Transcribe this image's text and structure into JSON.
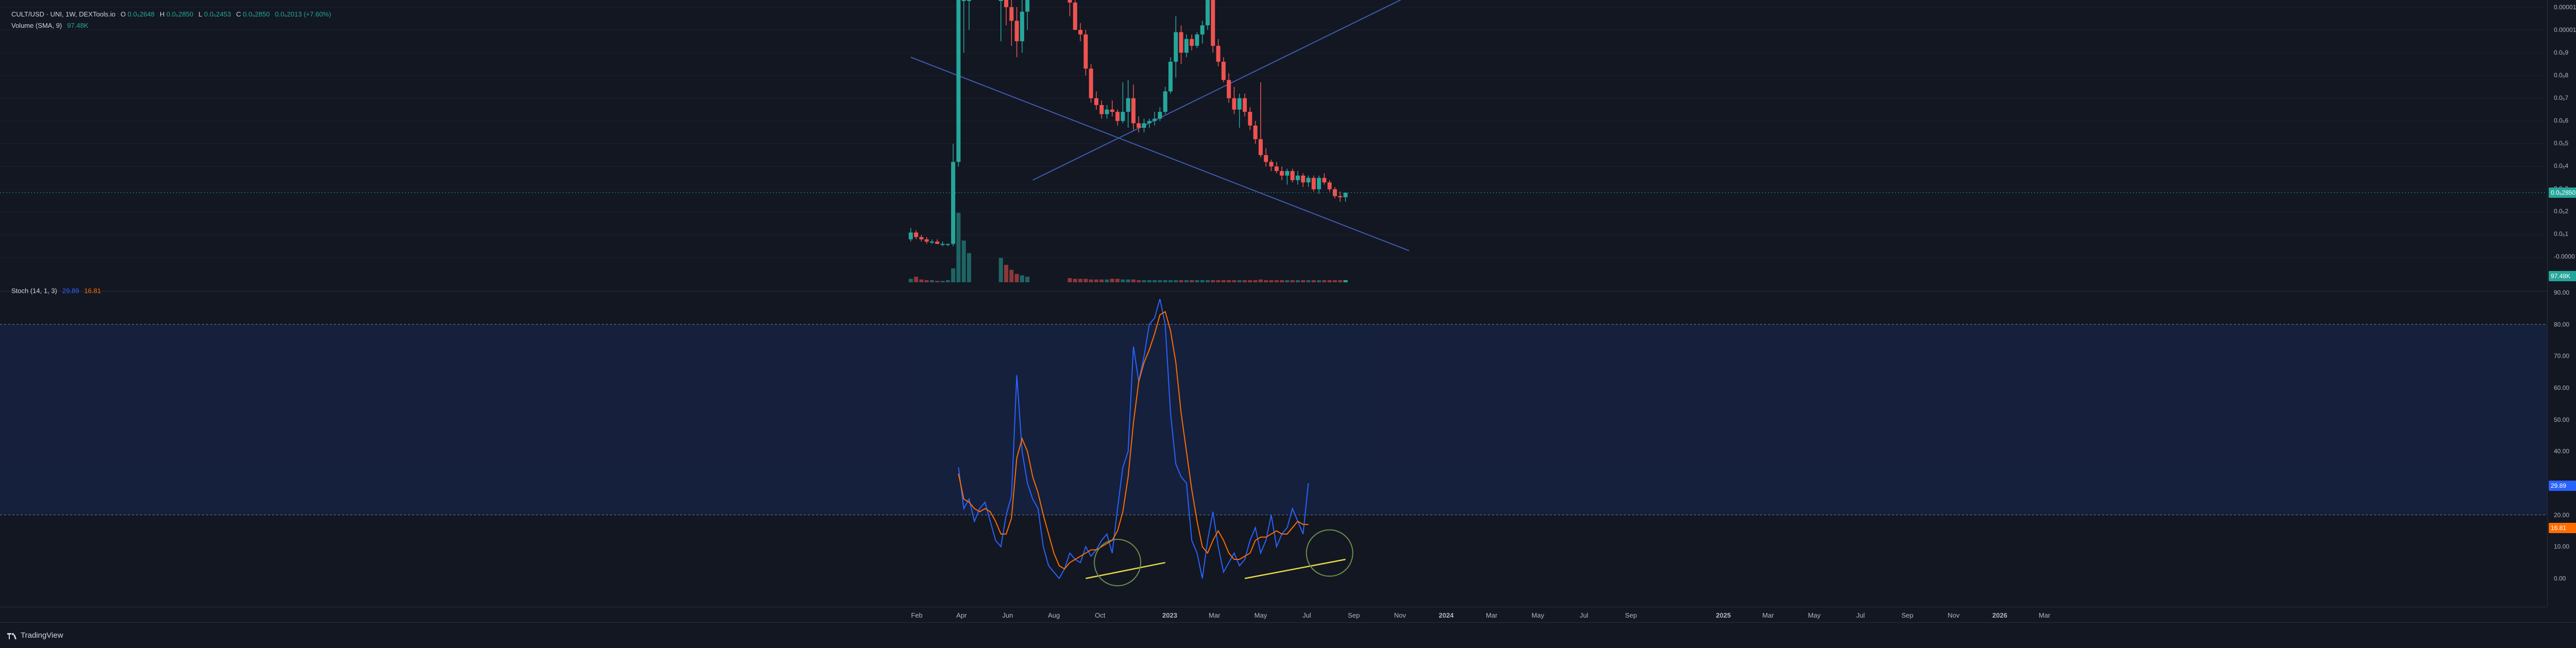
{
  "legend": {
    "symbol": "CULT/USD · UNI, 1W, DEXTools.io",
    "open_label": "O",
    "open_value": "0.0₅2648",
    "high_label": "H",
    "high_value": "0.0₅2850",
    "low_label": "L",
    "low_value": "0.0₅2453",
    "close_label": "C",
    "close_value": "0.0₅2850",
    "change": "0.0₆2013 (+7.60%)",
    "volume_label": "Volume (SMA, 9)",
    "volume_value": "97.48K",
    "stoch_label": "Stoch (14, 1, 3)",
    "stoch_k": "29.89",
    "stoch_d": "16.81"
  },
  "price_axis": {
    "ticks": [
      "0.00001100",
      "0.00001000",
      "0.0₅9",
      "0.0₅8",
      "0.0₅7",
      "0.0₅6",
      "0.0₅5",
      "0.0₅4",
      "0.0₅3",
      "0.0₅2",
      "0.0₅1",
      "-0.0000"
    ],
    "current_price_tag": "0.0₅2850",
    "volume_tag": "97.48K"
  },
  "stoch_axis": {
    "ticks": [
      "90.00",
      "80.00",
      "70.00",
      "60.00",
      "50.00",
      "40.00",
      "30.00",
      "20.00",
      "10.00",
      "0.00"
    ],
    "k_tag": "29.89",
    "d_tag": "16.81"
  },
  "time_axis": {
    "labels": [
      "Feb",
      "Apr",
      "Jun",
      "Aug",
      "Oct",
      "2023",
      "Mar",
      "May",
      "Jul",
      "Sep",
      "Nov",
      "2024",
      "Mar",
      "May",
      "Jul",
      "Sep",
      "2025",
      "Mar",
      "May",
      "Jul",
      "Sep",
      "Nov",
      "2026",
      "Mar"
    ]
  },
  "brand": {
    "name": "TradingView"
  },
  "colors": {
    "background": "#131722",
    "up": "#26a69a",
    "down": "#ef5350",
    "stoch_k": "#2962ff",
    "stoch_d": "#ff6d00",
    "trendline": "#3f5bb0",
    "divergence": "#e6d94a"
  },
  "chart_data": [
    {
      "type": "candlestick",
      "title": "CULT/USD · UNI, 1W, DEXTools.io",
      "y_unit": "price ×1e-6 USD",
      "ylim": [
        0,
        11
      ],
      "candles": [
        {
          "x": "2022-01-24",
          "o": 0.8,
          "h": 1.3,
          "l": 0.7,
          "c": 1.1
        },
        {
          "x": "2022-01-31",
          "o": 1.1,
          "h": 1.2,
          "l": 0.8,
          "c": 0.9
        },
        {
          "x": "2022-02-07",
          "o": 0.9,
          "h": 1.0,
          "l": 0.7,
          "c": 0.8
        },
        {
          "x": "2022-02-14",
          "o": 0.8,
          "h": 0.9,
          "l": 0.6,
          "c": 0.7
        },
        {
          "x": "2022-02-21",
          "o": 0.7,
          "h": 0.8,
          "l": 0.6,
          "c": 0.7
        },
        {
          "x": "2022-02-28",
          "o": 0.7,
          "h": 0.8,
          "l": 0.6,
          "c": 0.6
        },
        {
          "x": "2022-03-07",
          "o": 0.6,
          "h": 0.7,
          "l": 0.5,
          "c": 0.6
        },
        {
          "x": "2022-03-14",
          "o": 0.6,
          "h": 0.6,
          "l": 0.5,
          "c": 0.6
        },
        {
          "x": "2022-03-21",
          "o": 0.6,
          "h": 5.0,
          "l": 0.5,
          "c": 4.2
        },
        {
          "x": "2022-03-28",
          "o": 4.2,
          "h": 11.5,
          "l": 4.0,
          "c": 11.5
        },
        {
          "x": "2022-04-04",
          "o": 11.5,
          "h": 11.5,
          "l": 9.0,
          "c": 11.5
        },
        {
          "x": "2022-04-11",
          "o": 11.5,
          "h": 11.5,
          "l": 10.0,
          "c": 11.5
        },
        {
          "x": "2022-05-23",
          "o": 11.5,
          "h": 11.5,
          "l": 9.5,
          "c": 11.5
        },
        {
          "x": "2022-05-30",
          "o": 11.5,
          "h": 11.5,
          "l": 10.2,
          "c": 11.0
        },
        {
          "x": "2022-06-06",
          "o": 11.0,
          "h": 11.5,
          "l": 9.3,
          "c": 10.4
        },
        {
          "x": "2022-06-13",
          "o": 10.4,
          "h": 11.0,
          "l": 8.8,
          "c": 9.5
        },
        {
          "x": "2022-06-20",
          "o": 9.5,
          "h": 11.5,
          "l": 9.0,
          "c": 10.8
        },
        {
          "x": "2022-06-27",
          "o": 10.8,
          "h": 11.5,
          "l": 10.0,
          "c": 11.5
        },
        {
          "x": "2022-08-22",
          "o": 11.5,
          "h": 11.5,
          "l": 10.6,
          "c": 11.2
        },
        {
          "x": "2022-08-29",
          "o": 11.2,
          "h": 11.3,
          "l": 10.0,
          "c": 10.0
        },
        {
          "x": "2022-09-05",
          "o": 10.0,
          "h": 10.3,
          "l": 9.5,
          "c": 9.8
        },
        {
          "x": "2022-09-12",
          "o": 9.8,
          "h": 10.0,
          "l": 8.0,
          "c": 8.3
        },
        {
          "x": "2022-09-19",
          "o": 8.3,
          "h": 8.5,
          "l": 6.8,
          "c": 7.0
        },
        {
          "x": "2022-09-26",
          "o": 7.0,
          "h": 7.3,
          "l": 6.5,
          "c": 6.7
        },
        {
          "x": "2022-10-03",
          "o": 6.7,
          "h": 6.9,
          "l": 6.1,
          "c": 6.3
        },
        {
          "x": "2022-10-10",
          "o": 6.3,
          "h": 6.7,
          "l": 6.1,
          "c": 6.5
        },
        {
          "x": "2022-10-17",
          "o": 6.5,
          "h": 6.9,
          "l": 6.2,
          "c": 6.4
        },
        {
          "x": "2022-10-24",
          "o": 6.4,
          "h": 6.5,
          "l": 5.8,
          "c": 6.0
        },
        {
          "x": "2022-10-31",
          "o": 6.0,
          "h": 7.7,
          "l": 5.9,
          "c": 6.4
        },
        {
          "x": "2022-11-07",
          "o": 6.4,
          "h": 7.8,
          "l": 5.7,
          "c": 7.0
        },
        {
          "x": "2022-11-14",
          "o": 7.0,
          "h": 7.6,
          "l": 5.6,
          "c": 5.9
        },
        {
          "x": "2022-11-21",
          "o": 5.9,
          "h": 6.2,
          "l": 5.5,
          "c": 5.7
        },
        {
          "x": "2022-11-28",
          "o": 5.7,
          "h": 6.1,
          "l": 5.5,
          "c": 5.9
        },
        {
          "x": "2022-12-05",
          "o": 5.9,
          "h": 6.1,
          "l": 5.7,
          "c": 6.0
        },
        {
          "x": "2022-12-12",
          "o": 6.0,
          "h": 6.4,
          "l": 5.8,
          "c": 6.1
        },
        {
          "x": "2022-12-19",
          "o": 6.1,
          "h": 6.6,
          "l": 6.0,
          "c": 6.4
        },
        {
          "x": "2022-12-26",
          "o": 6.4,
          "h": 7.5,
          "l": 6.3,
          "c": 7.3
        },
        {
          "x": "2023-01-02",
          "o": 7.3,
          "h": 8.8,
          "l": 7.2,
          "c": 8.6
        },
        {
          "x": "2023-01-09",
          "o": 8.6,
          "h": 10.6,
          "l": 7.9,
          "c": 9.9
        },
        {
          "x": "2023-01-16",
          "o": 9.9,
          "h": 10.2,
          "l": 8.5,
          "c": 9.0
        },
        {
          "x": "2023-01-23",
          "o": 9.0,
          "h": 9.8,
          "l": 8.8,
          "c": 9.6
        },
        {
          "x": "2023-01-30",
          "o": 9.6,
          "h": 9.8,
          "l": 9.1,
          "c": 9.3
        },
        {
          "x": "2023-02-06",
          "o": 9.3,
          "h": 9.9,
          "l": 9.2,
          "c": 9.8
        },
        {
          "x": "2023-02-13",
          "o": 9.8,
          "h": 10.4,
          "l": 9.4,
          "c": 10.2
        },
        {
          "x": "2023-02-20",
          "o": 10.2,
          "h": 11.5,
          "l": 10.0,
          "c": 11.5
        },
        {
          "x": "2023-02-27",
          "o": 11.5,
          "h": 11.5,
          "l": 9.0,
          "c": 9.3
        },
        {
          "x": "2023-03-06",
          "o": 9.3,
          "h": 9.6,
          "l": 8.4,
          "c": 8.6
        },
        {
          "x": "2023-03-13",
          "o": 8.6,
          "h": 8.8,
          "l": 7.7,
          "c": 7.8
        },
        {
          "x": "2023-03-20",
          "o": 7.8,
          "h": 8.1,
          "l": 6.8,
          "c": 7.0
        },
        {
          "x": "2023-03-27",
          "o": 7.0,
          "h": 7.5,
          "l": 6.3,
          "c": 6.5
        },
        {
          "x": "2023-04-03",
          "o": 6.5,
          "h": 7.2,
          "l": 5.7,
          "c": 7.0
        },
        {
          "x": "2023-04-10",
          "o": 7.0,
          "h": 7.2,
          "l": 6.2,
          "c": 6.4
        },
        {
          "x": "2023-04-17",
          "o": 6.4,
          "h": 6.6,
          "l": 5.6,
          "c": 5.8
        },
        {
          "x": "2023-04-24",
          "o": 5.8,
          "h": 6.0,
          "l": 5.0,
          "c": 5.2
        },
        {
          "x": "2023-05-01",
          "o": 5.2,
          "h": 7.7,
          "l": 4.4,
          "c": 4.5
        },
        {
          "x": "2023-05-08",
          "o": 4.5,
          "h": 4.8,
          "l": 4.0,
          "c": 4.2
        },
        {
          "x": "2023-05-15",
          "o": 4.2,
          "h": 4.3,
          "l": 3.8,
          "c": 4.0
        },
        {
          "x": "2023-05-22",
          "o": 4.0,
          "h": 4.2,
          "l": 3.7,
          "c": 3.8
        },
        {
          "x": "2023-05-29",
          "o": 3.8,
          "h": 4.0,
          "l": 3.4,
          "c": 3.6
        },
        {
          "x": "2023-06-05",
          "o": 3.6,
          "h": 3.9,
          "l": 3.2,
          "c": 3.8
        },
        {
          "x": "2023-06-12",
          "o": 3.8,
          "h": 3.9,
          "l": 3.3,
          "c": 3.4
        },
        {
          "x": "2023-06-19",
          "o": 3.4,
          "h": 3.8,
          "l": 3.2,
          "c": 3.6
        },
        {
          "x": "2023-06-26",
          "o": 3.6,
          "h": 3.7,
          "l": 3.1,
          "c": 3.3
        },
        {
          "x": "2023-07-03",
          "o": 3.3,
          "h": 3.6,
          "l": 3.1,
          "c": 3.5
        },
        {
          "x": "2023-07-10",
          "o": 3.5,
          "h": 3.6,
          "l": 2.9,
          "c": 3.0
        },
        {
          "x": "2023-07-17",
          "o": 3.0,
          "h": 3.6,
          "l": 2.8,
          "c": 3.5
        },
        {
          "x": "2023-07-24",
          "o": 3.5,
          "h": 3.7,
          "l": 3.2,
          "c": 3.3
        },
        {
          "x": "2023-07-31",
          "o": 3.3,
          "h": 3.4,
          "l": 2.9,
          "c": 3.0
        },
        {
          "x": "2023-08-07",
          "o": 3.0,
          "h": 3.1,
          "l": 2.6,
          "c": 2.7
        },
        {
          "x": "2023-08-14",
          "o": 2.7,
          "h": 2.9,
          "l": 2.45,
          "c": 2.648
        },
        {
          "x": "2023-08-21",
          "o": 2.648,
          "h": 2.85,
          "l": 2.453,
          "c": 2.85
        }
      ],
      "trendlines": [
        {
          "from": {
            "x": "2022-01-24",
            "y": 8.8
          },
          "to": {
            "x": "2023-11-13",
            "y": 0.3
          }
        },
        {
          "from": {
            "x": "2022-07-04",
            "y": 3.4
          },
          "to": {
            "x": "2023-11-13",
            "y": 11.5
          }
        }
      ]
    },
    {
      "type": "bar",
      "title": "Volume (SMA, 9)",
      "last_value": "97.48K",
      "values_relative": [
        0.05,
        0.08,
        0.04,
        0.03,
        0.03,
        0.02,
        0.02,
        0.03,
        0.2,
        1.0,
        0.6,
        0.42,
        0.35,
        0.25,
        0.18,
        0.12,
        0.1,
        0.08,
        0.06,
        0.05,
        0.05,
        0.05,
        0.04,
        0.04,
        0.04,
        0.04,
        0.05,
        0.05,
        0.04,
        0.04,
        0.04,
        0.03,
        0.03,
        0.03,
        0.03,
        0.03,
        0.03,
        0.03,
        0.03,
        0.03,
        0.03,
        0.03,
        0.03,
        0.03,
        0.03,
        0.03,
        0.03,
        0.03,
        0.03,
        0.03,
        0.03,
        0.03,
        0.03,
        0.03,
        0.04,
        0.03,
        0.03,
        0.03,
        0.03,
        0.03,
        0.03,
        0.03,
        0.03,
        0.03,
        0.03,
        0.03,
        0.03,
        0.03,
        0.03,
        0.03,
        0.03,
        0.03,
        0.03,
        0.03,
        0.03,
        0.03,
        0.03,
        0.03,
        0.03,
        0.03
      ]
    },
    {
      "type": "line",
      "title": "Stoch (14, 1, 3)",
      "ylim": [
        -8,
        94
      ],
      "bands": [
        20,
        80
      ],
      "series": [
        {
          "name": "%K",
          "x_start": "2022-03-28",
          "values": [
            35,
            22,
            25,
            18,
            22,
            24,
            18,
            12,
            10,
            20,
            26,
            64,
            40,
            30,
            25,
            22,
            10,
            4,
            2,
            0,
            3,
            8,
            6,
            5,
            10,
            7,
            9,
            12,
            14,
            8,
            22,
            35,
            40,
            73,
            62,
            70,
            80,
            82,
            88,
            80,
            52,
            36,
            32,
            30,
            12,
            8,
            0,
            12,
            21,
            10,
            2,
            5,
            8,
            4,
            6,
            12,
            16,
            8,
            12,
            20,
            10,
            14,
            16,
            22,
            18,
            14,
            30
          ]
        },
        {
          "name": "%D",
          "x_start": "2022-03-28",
          "values": [
            33,
            25,
            24,
            22,
            21,
            22,
            21,
            18,
            14,
            14,
            19,
            38,
            44,
            40,
            32,
            27,
            20,
            14,
            8,
            4,
            3,
            5,
            6,
            7,
            8,
            9,
            9,
            10,
            11,
            12,
            15,
            21,
            32,
            49,
            62,
            68,
            72,
            77,
            83,
            84,
            78,
            68,
            52,
            40,
            28,
            18,
            10,
            8,
            12,
            15,
            12,
            8,
            6,
            6,
            7,
            8,
            12,
            13,
            13,
            14,
            15,
            14,
            14,
            16,
            18,
            17,
            17
          ]
        }
      ],
      "divergence_lines": [
        {
          "from": {
            "x": "2022-09-12",
            "y": 0
          },
          "to": {
            "x": "2022-12-26",
            "y": 5
          }
        },
        {
          "from": {
            "x": "2023-04-10",
            "y": 0
          },
          "to": {
            "x": "2023-08-21",
            "y": 6
          }
        }
      ],
      "circles": [
        {
          "x": "2022-10-24",
          "y": 5
        },
        {
          "x": "2023-07-31",
          "y": 8
        }
      ]
    }
  ]
}
